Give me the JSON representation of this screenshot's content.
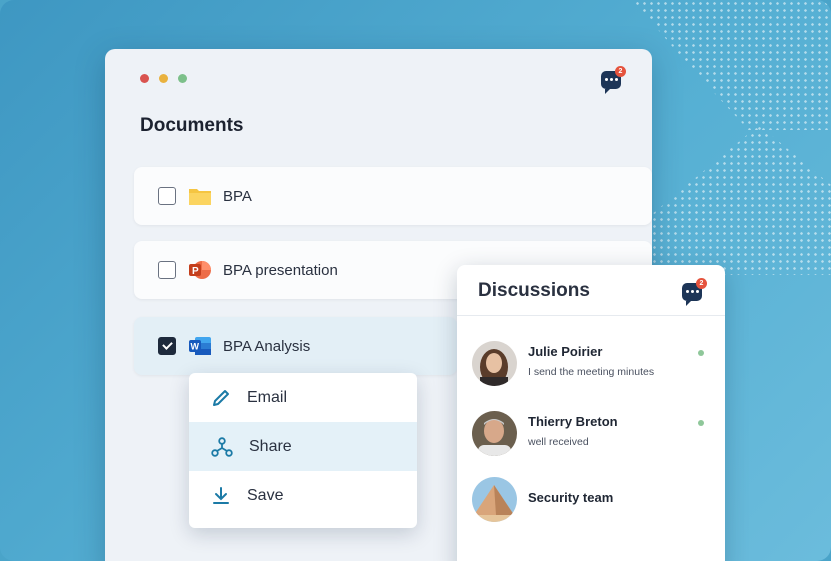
{
  "window": {
    "traffic_lights": [
      "#d9534f",
      "#e9b23f",
      "#7cc08a"
    ],
    "chat_badge": "2",
    "title": "Documents"
  },
  "documents": [
    {
      "name": "BPA",
      "icon": "folder-icon",
      "checked": false
    },
    {
      "name": "BPA presentation",
      "icon": "powerpoint-icon",
      "checked": false
    },
    {
      "name": "BPA Analysis",
      "icon": "word-icon",
      "checked": true
    }
  ],
  "context_menu": {
    "items": [
      {
        "label": "Email",
        "icon": "pencil-icon"
      },
      {
        "label": "Share",
        "icon": "share-icon"
      },
      {
        "label": "Save",
        "icon": "download-icon"
      }
    ]
  },
  "discussions": {
    "title": "Discussions",
    "chat_badge": "2",
    "contacts": [
      {
        "name": "Julie Poirier",
        "message": "I send the meeting minutes",
        "online": true,
        "avatar": "person-avatar"
      },
      {
        "name": "Thierry Breton",
        "message": "well received",
        "online": true,
        "avatar": "person-avatar"
      },
      {
        "name": "Security team",
        "message": "",
        "online": false,
        "avatar": "pyramid-avatar"
      }
    ]
  },
  "colors": {
    "accent": "#1b7aa6",
    "navy": "#1d3557",
    "badge": "#e5533d",
    "online": "#8fc79a"
  }
}
